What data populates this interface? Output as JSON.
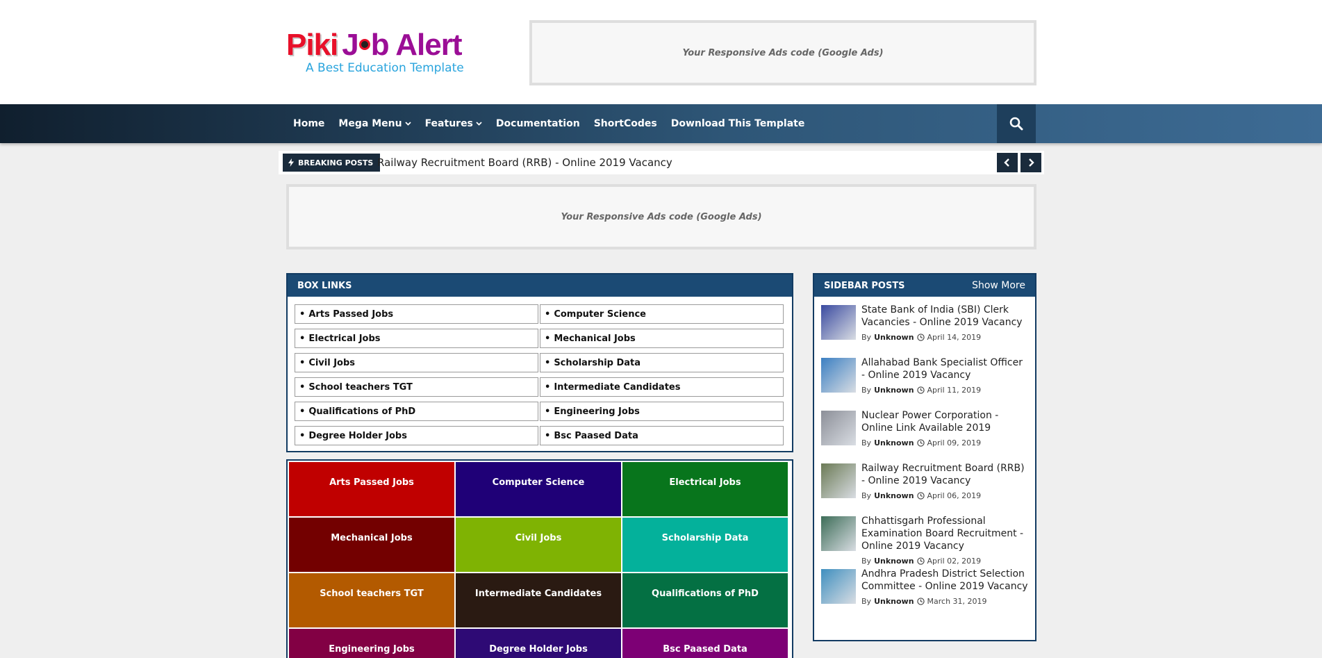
{
  "logo": {
    "piki": "Piki",
    "job_before": "J",
    "job_after": "b Alert",
    "tagline": "A Best Education Template"
  },
  "ads": {
    "top": "Your Responsive Ads code (Google Ads)",
    "middle": "Your Responsive Ads code (Google Ads)"
  },
  "nav": {
    "items": [
      {
        "label": "Home",
        "dropdown": false
      },
      {
        "label": "Mega Menu",
        "dropdown": true
      },
      {
        "label": "Features",
        "dropdown": true
      },
      {
        "label": "Documentation",
        "dropdown": false
      },
      {
        "label": "ShortCodes",
        "dropdown": false
      },
      {
        "label": "Download This Template",
        "dropdown": false
      }
    ]
  },
  "ticker": {
    "label": "BREAKING POSTS",
    "text": "Railway Recruitment Board (RRB) - Online 2019 Vacancy"
  },
  "box_links": {
    "title": "BOX LINKS",
    "items": [
      "Arts Passed Jobs",
      "Computer Science",
      "Electrical Jobs",
      "Mechanical Jobs",
      "Civil Jobs",
      "Scholarship Data",
      "School teachers TGT",
      "Intermediate Candidates",
      "Qualifications of PhD",
      "Engineering Jobs",
      "Degree Holder Jobs",
      "Bsc Paased Data"
    ]
  },
  "tiles": [
    {
      "label": "Arts Passed Jobs",
      "color": "#c00000"
    },
    {
      "label": "Computer Science",
      "color": "#1f0077"
    },
    {
      "label": "Electrical Jobs",
      "color": "#08751c"
    },
    {
      "label": "Mechanical Jobs",
      "color": "#730000"
    },
    {
      "label": "Civil Jobs",
      "color": "#7fb303"
    },
    {
      "label": "Scholarship Data",
      "color": "#04b19b"
    },
    {
      "label": "School teachers TGT",
      "color": "#b35a00"
    },
    {
      "label": "Intermediate Candidates",
      "color": "#2a1a12"
    },
    {
      "label": "Qualifications of PhD",
      "color": "#047043"
    },
    {
      "label": "Engineering Jobs",
      "color": "#820044"
    },
    {
      "label": "Degree Holder Jobs",
      "color": "#2e0a75"
    },
    {
      "label": "Bsc Paased Data",
      "color": "#7d0075"
    }
  ],
  "sidebar": {
    "title": "SIDEBAR POSTS",
    "more": "Show More",
    "by": "By",
    "posts": [
      {
        "title": "State Bank of India (SBI) Clerk Vacancies - Online 2019 Vacancy",
        "author": "Unknown",
        "date": "April 14, 2019",
        "thumb": "#3a4aa0"
      },
      {
        "title": "Allahabad Bank Specialist Officer - Online 2019 Vacancy",
        "author": "Unknown",
        "date": "April 11, 2019",
        "thumb": "#3b7fc2"
      },
      {
        "title": "Nuclear Power Corporation - Online Link Available 2019",
        "author": "Unknown",
        "date": "April 09, 2019",
        "thumb": "#8c8f98"
      },
      {
        "title": "Railway Recruitment Board (RRB) - Online 2019 Vacancy",
        "author": "Unknown",
        "date": "April 06, 2019",
        "thumb": "#6b7a55"
      },
      {
        "title": "Chhattisgarh Professional Examination Board Recruitment - Online 2019 Vacancy",
        "author": "Unknown",
        "date": "April 02, 2019",
        "thumb": "#3d6d58"
      },
      {
        "title": "Andhra Pradesh District Selection Committee - Online 2019 Vacancy",
        "author": "Unknown",
        "date": "March 31, 2019",
        "thumb": "#3f8fbf"
      }
    ]
  }
}
